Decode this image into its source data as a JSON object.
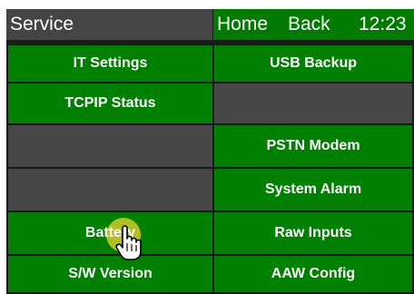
{
  "header": {
    "title": "Service",
    "home_label": "Home",
    "back_label": "Back",
    "time": "12:23"
  },
  "menu": {
    "it_settings": "IT Settings",
    "usb_backup": "USB Backup",
    "tcpip_status": "TCPIP Status",
    "pstn_modem": "PSTN Modem",
    "system_alarm": "System Alarm",
    "battery": "Battery",
    "raw_inputs": "Raw Inputs",
    "sw_version": "S/W Version",
    "aaw_config": "AAW Config"
  },
  "colors": {
    "button_green": "#008000",
    "header_green": "#007a00",
    "disabled_gray": "#474747",
    "header_gray": "#454545",
    "touch_highlight": "#c4c428"
  },
  "icons": {
    "cursor": "hand-pointer-icon"
  }
}
